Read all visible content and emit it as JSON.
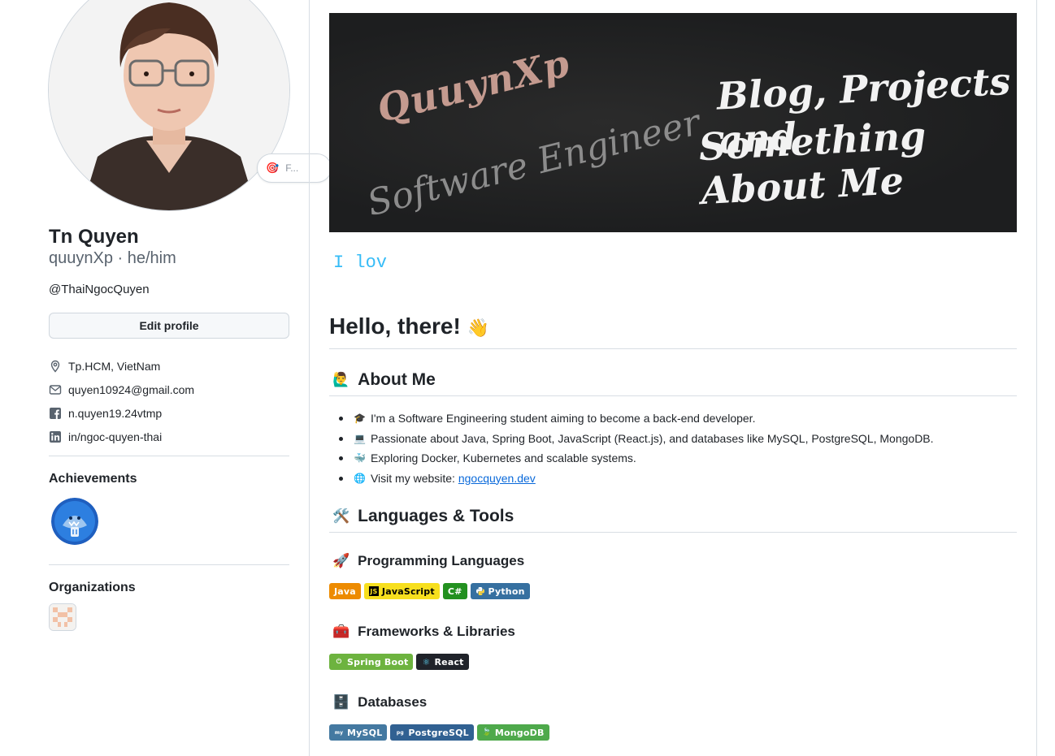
{
  "profile": {
    "status_emoji": "🎯",
    "status_text": "F...",
    "name": "Tn Quyen",
    "login": "quuynXp · he/him",
    "bio": "@ThaiNgocQuyen",
    "edit_label": "Edit profile",
    "vcard": {
      "location": "Tp.HCM, VietNam",
      "email": "quyen10924@gmail.com",
      "facebook": "n.quyen19.24vtmp",
      "linkedin": "in/ngoc-quyen-thai"
    },
    "achievements_title": "Achievements",
    "organizations_title": "Organizations"
  },
  "readme": {
    "banner": {
      "brand": "QuuynXp",
      "role": "Software Engineer",
      "tagline_1": "Blog, Projects and",
      "tagline_2": "Something About Me"
    },
    "typing_text": "I lov",
    "greeting": "Hello, there!",
    "greeting_emoji": "👋",
    "about": {
      "emoji": "🙋‍♂️",
      "title": "About Me",
      "items": [
        {
          "emoji": "🎓",
          "text": "I'm a Software Engineering student aiming to become a back-end developer."
        },
        {
          "emoji": "💻",
          "text": "Passionate about Java, Spring Boot, JavaScript (React.js), and databases like MySQL, PostgreSQL, MongoDB."
        },
        {
          "emoji": "🐳",
          "text": "Exploring Docker, Kubernetes and scalable systems."
        },
        {
          "emoji": "🌐",
          "text": "Visit my website: ",
          "link": "ngocquyen.dev"
        }
      ]
    },
    "tools": {
      "emoji": "🛠️",
      "title": "Languages & Tools",
      "programming": {
        "emoji": "🚀",
        "title": "Programming Languages",
        "badges": [
          {
            "label": "Java",
            "color": "#ED8B00",
            "logo": ""
          },
          {
            "label": "JavaScript",
            "color": "#F7DF1E",
            "text_color": "#000000",
            "logo": "JS"
          },
          {
            "label": "C#",
            "color": "#239120",
            "logo": ""
          },
          {
            "label": "Python",
            "color": "#3670A0",
            "logo": "py"
          }
        ]
      },
      "frameworks": {
        "emoji": "🧰",
        "title": "Frameworks & Libraries",
        "badges": [
          {
            "label": "Spring Boot",
            "color": "#6DB33F",
            "logo": "⏻"
          },
          {
            "label": "React",
            "color": "#20232A",
            "logo": "⚛"
          }
        ]
      },
      "databases": {
        "emoji": "🗄️",
        "title": "Databases",
        "badges": [
          {
            "label": "MySQL",
            "color": "#4479A1",
            "logo": "my"
          },
          {
            "label": "PostgreSQL",
            "color": "#316192",
            "logo": "pg"
          },
          {
            "label": "MongoDB",
            "color": "#4EA94B",
            "logo": "🍃"
          }
        ]
      }
    }
  },
  "colors": {
    "accent_link": "#0969da",
    "typing": "#36bcf7",
    "banner_bg": "#1d1e1f"
  }
}
